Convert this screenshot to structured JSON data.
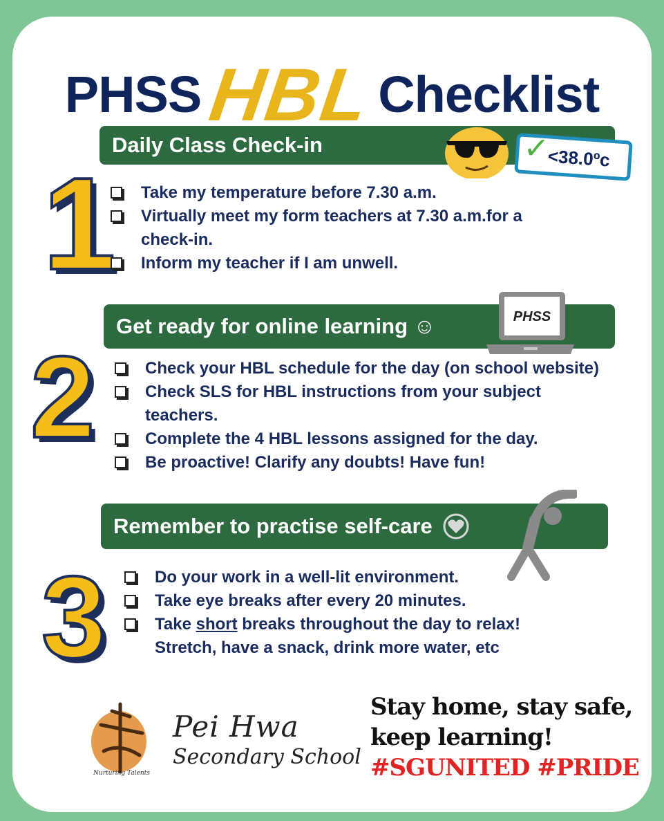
{
  "title": {
    "part1": "PHSS",
    "part2": "HBL",
    "part3": "Checklist"
  },
  "sections": [
    {
      "number": "1",
      "heading": "Daily Class Check-in",
      "items": [
        "Take my temperature before 7.30 a.m.",
        "Virtually meet my form teachers at 7.30 a.m.for a check-in.",
        "Inform my teacher if I am unwell."
      ]
    },
    {
      "number": "2",
      "heading": "Get ready for online learning ☺",
      "items": [
        "Check your HBL schedule for the day (on school website)",
        "Check SLS for HBL instructions from your subject teachers.",
        "Complete the 4 HBL lessons assigned for the day.",
        "Be proactive! Clarify any doubts! Have fun!"
      ]
    },
    {
      "number": "3",
      "heading": "Remember to practise self-care",
      "items": [
        "Do your work in a well-lit environment.",
        "Take eye breaks after every 20 minutes."
      ],
      "item3_pre": "Take ",
      "item3_u": "short",
      "item3_post": " breaks throughout the day to relax! Stretch, have a snack, drink more water, etc"
    }
  ],
  "temp_badge": {
    "check": "✓",
    "text": "<38.0ºc"
  },
  "laptop_label": "PHSS",
  "school": {
    "line1": "Pei Hwa",
    "line2": "Secondary School",
    "logo_text": "Nurturing Talents"
  },
  "slogan": {
    "line1": "Stay home, stay safe,",
    "line2": "keep learning!",
    "line3": "#SGUNITED #PRIDE"
  },
  "colors": {
    "banner": "#2d6a40",
    "navy": "#10245c",
    "gold": "#e8b51c",
    "border": "#80c596",
    "red": "#e02323"
  },
  "icons": [
    "cool-sunglasses-emoji-icon",
    "laptop-icon",
    "stretching-person-icon",
    "heart-icon",
    "checkmark-icon"
  ]
}
